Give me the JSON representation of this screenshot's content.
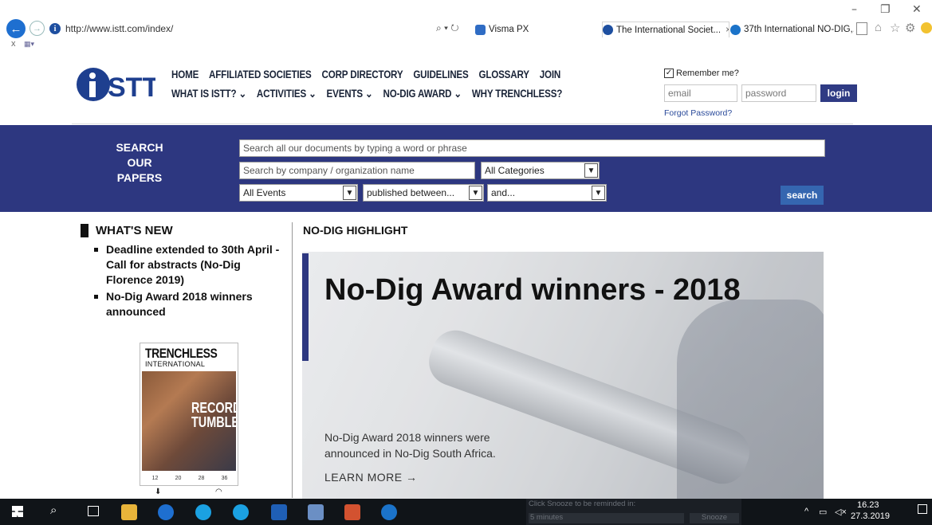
{
  "browser": {
    "url": "http://www.istt.com/index/",
    "tabs": [
      {
        "label": "Visma PX",
        "icon": "visma-icon",
        "color": "#2f6cc4"
      },
      {
        "label": "The International Societ...",
        "icon": "istt-favicon",
        "color": "#1e4fa0"
      },
      {
        "label": "37th International NO-DIG,...",
        "icon": "nodig-favicon",
        "color": "#1b73c9"
      }
    ],
    "tab_close": "×",
    "search_glyph": "⌕ ▾ ↻",
    "x_label": "x"
  },
  "site": {
    "logo_text": "ISTT",
    "nav_row1": [
      "HOME",
      "AFFILIATED SOCIETIES",
      "CORP DIRECTORY",
      "GUIDELINES",
      "GLOSSARY",
      "JOIN"
    ],
    "nav_row2": [
      "WHAT IS ISTT? ⌄",
      "ACTIVITIES ⌄",
      "EVENTS ⌄",
      "NO-DIG AWARD ⌄",
      "WHY TRENCHLESS?"
    ],
    "login": {
      "remember": "Remember me?",
      "email_placeholder": "email",
      "password_placeholder": "password",
      "button": "login",
      "forgot": "Forgot Password?"
    },
    "accent": "#2d3780"
  },
  "search": {
    "title": "SEARCH OUR PAPERS",
    "docs_placeholder": "Search all our documents by typing a word or phrase",
    "company_placeholder": "Search by company / organization name",
    "category": "All Categories",
    "events": "All Events",
    "between": "published between...",
    "and": "and...",
    "button": "search"
  },
  "whats_new": {
    "title": "WHAT'S NEW",
    "items": [
      "Deadline extended to 30th April - Call for abstracts (No-Dig Florence 2019)",
      "No-Dig Award 2018 winners announced"
    ]
  },
  "magazine": {
    "title": "TRENCHLESS",
    "subtitle": "INTERNATIONAL",
    "cover_headline": "RECORD TUMBLES",
    "footer_numbers": [
      "12",
      "20",
      "28",
      "36"
    ]
  },
  "highlight": {
    "section": "NO-DIG HIGHLIGHT",
    "heading": "No-Dig Award winners - 2018",
    "desc": "No-Dig Award 2018 winners were announced in No-Dig South Africa.",
    "more": "LEARN MORE →"
  },
  "taskbar": {
    "notification": "Click Snooze to be reminded in:",
    "snooze_option": "5 minutes",
    "snooze": "Snooze",
    "time": "16.23",
    "date": "27.3.2019"
  }
}
